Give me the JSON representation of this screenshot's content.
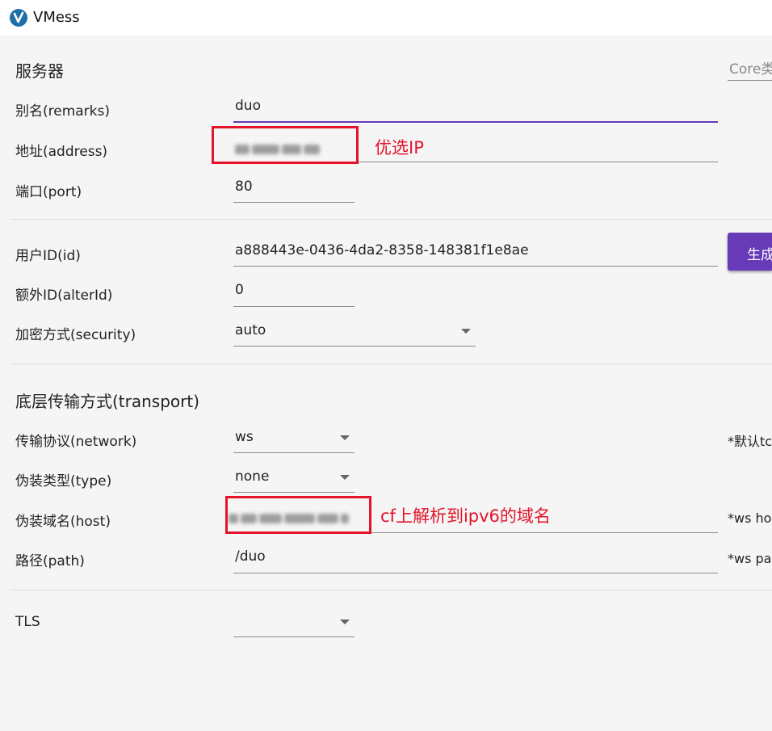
{
  "window": {
    "title": "VMess",
    "icon": "v2rayn-logo-icon"
  },
  "server_section": {
    "heading": "服务器",
    "core_type_label": "Core类",
    "remarks": {
      "label": "别名(remarks)",
      "value": "duo"
    },
    "address": {
      "label": "地址(address)",
      "value": ""
    },
    "port": {
      "label": "端口(port)",
      "value": "80"
    }
  },
  "user_section": {
    "id": {
      "label": "用户ID(id)",
      "value": "a888443e-0436-4da2-8358-148381f1e8ae"
    },
    "generate_button": "生成",
    "alter_id": {
      "label": "额外ID(alterId)",
      "value": "0"
    },
    "security": {
      "label": "加密方式(security)",
      "value": "auto"
    }
  },
  "transport_section": {
    "heading": "底层传输方式(transport)",
    "network": {
      "label": "传输协议(network)",
      "value": "ws",
      "hint": "*默认tc"
    },
    "type": {
      "label": "伪装类型(type)",
      "value": "none"
    },
    "host": {
      "label": "伪装域名(host)",
      "value": "",
      "hint": "*ws hos"
    },
    "path": {
      "label": "路径(path)",
      "value": "/duo",
      "hint": "*ws pa"
    }
  },
  "tls": {
    "label": "TLS",
    "value": ""
  },
  "annotations": {
    "address_note": "优选IP",
    "host_note": "cf上解析到ipv6的域名",
    "color": "#e5142a"
  },
  "colors": {
    "accent": "#673ab7",
    "background": "#f5f5f5"
  }
}
